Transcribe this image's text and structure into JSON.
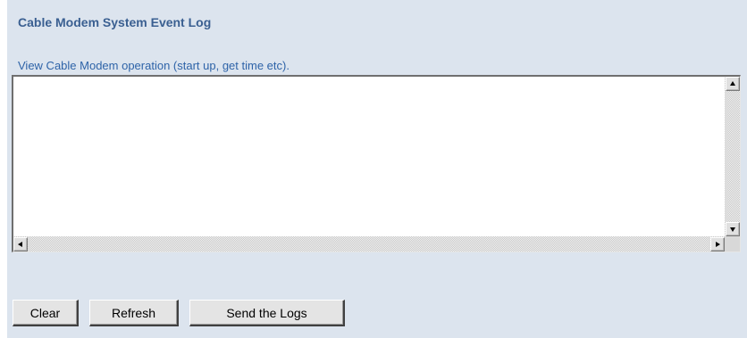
{
  "page": {
    "title": "Cable Modem System Event Log",
    "subtitle": "View Cable Modem operation (start up, get time etc)."
  },
  "log": {
    "content": ""
  },
  "buttons": {
    "clear": "Clear",
    "refresh": "Refresh",
    "send_logs": "Send the Logs"
  },
  "colors": {
    "panel_background": "#dce4ee",
    "title": "#3a5f91",
    "subtitle": "#2e63a8"
  },
  "icons": {
    "scroll_up": "triangle-up-icon",
    "scroll_down": "triangle-down-icon",
    "scroll_left": "triangle-left-icon",
    "scroll_right": "triangle-right-icon"
  }
}
